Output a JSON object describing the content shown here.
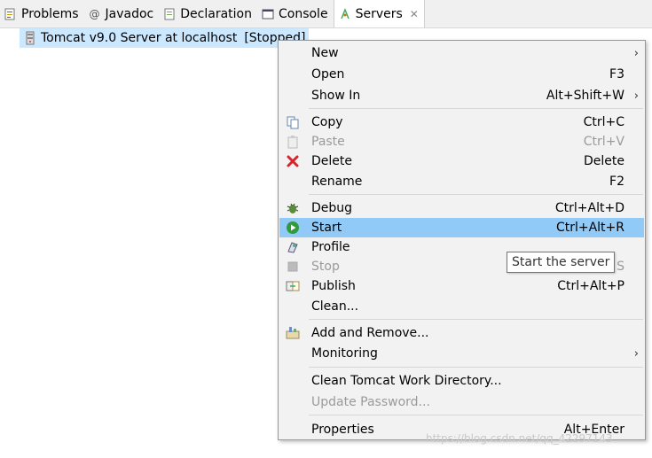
{
  "tabs": [
    {
      "label": "Problems",
      "icon": "problems-icon"
    },
    {
      "label": "Javadoc",
      "icon": "javadoc-icon"
    },
    {
      "label": "Declaration",
      "icon": "declaration-icon"
    },
    {
      "label": "Console",
      "icon": "console-icon"
    },
    {
      "label": "Servers",
      "icon": "servers-icon",
      "close": "✕"
    }
  ],
  "tree": {
    "server_label": "Tomcat v9.0 Server at localhost",
    "status": "[Stopped]"
  },
  "menu": {
    "new": {
      "label": "New",
      "arrow": "›"
    },
    "open": {
      "label": "Open",
      "shortcut": "F3"
    },
    "show_in": {
      "label": "Show In",
      "shortcut": "Alt+Shift+W",
      "arrow": "›"
    },
    "copy": {
      "label": "Copy",
      "shortcut": "Ctrl+C"
    },
    "paste": {
      "label": "Paste",
      "shortcut": "Ctrl+V"
    },
    "delete": {
      "label": "Delete",
      "shortcut": "Delete"
    },
    "rename": {
      "label": "Rename",
      "shortcut": "F2"
    },
    "debug": {
      "label": "Debug",
      "shortcut": "Ctrl+Alt+D"
    },
    "start": {
      "label": "Start",
      "shortcut": "Ctrl+Alt+R"
    },
    "profile": {
      "label": "Profile"
    },
    "stop": {
      "label": "Stop",
      "shortcut": "S"
    },
    "publish": {
      "label": "Publish",
      "shortcut": "Ctrl+Alt+P"
    },
    "clean": {
      "label": "Clean..."
    },
    "add_remove": {
      "label": "Add and Remove..."
    },
    "monitoring": {
      "label": "Monitoring",
      "arrow": "›"
    },
    "clean_work_dir": {
      "label": "Clean Tomcat Work Directory..."
    },
    "update_password": {
      "label": "Update Password..."
    },
    "properties": {
      "label": "Properties",
      "shortcut": "Alt+Enter"
    }
  },
  "tooltip": "Start the server",
  "watermark": "https://blog.csdn.net/qq_42297143",
  "colors": {
    "hover": "#91c9f7",
    "selection": "#cce8ff",
    "menu_bg": "#f2f2f2",
    "delete_red": "#d9232a",
    "start_green": "#2e9c3a"
  }
}
